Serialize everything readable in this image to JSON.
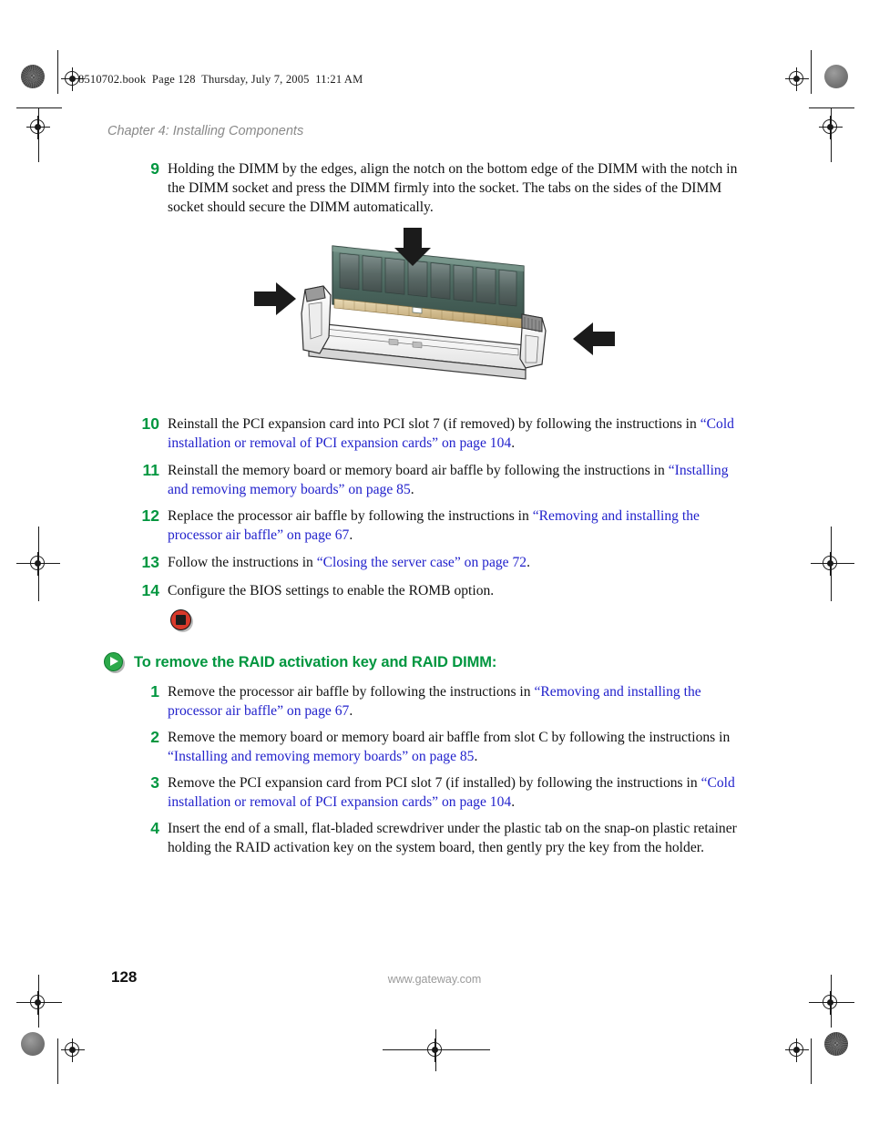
{
  "header": {
    "book_line": "8510702.book  Page 128  Thursday, July 7, 2005  11:21 AM",
    "chapter": "Chapter 4: Installing Components"
  },
  "footer": {
    "page_number": "128",
    "url": "www.gateway.com"
  },
  "colors": {
    "step_number_green": "#00963f",
    "xref_blue": "#2222cc",
    "heading_green": "#00963f",
    "stop_red": "#d8392b",
    "play_green": "#2ca94a",
    "chapter_gray": "#8a8a8a"
  },
  "steps_install": [
    {
      "number": "9",
      "parts": [
        {
          "text": "Holding the DIMM by the edges, align the notch on the bottom edge of the DIMM with the notch in the DIMM socket and press the DIMM firmly into the socket. The tabs on the sides of the DIMM socket should secure the DIMM automatically.",
          "style": "plain"
        }
      ]
    },
    {
      "number": "10",
      "parts": [
        {
          "text": "Reinstall the PCI expansion card into PCI slot 7 (if removed) by following the instructions in ",
          "style": "plain"
        },
        {
          "text": "“Cold installation or removal of PCI expansion cards” on page 104",
          "style": "xref"
        },
        {
          "text": ".",
          "style": "plain"
        }
      ]
    },
    {
      "number": "11",
      "parts": [
        {
          "text": "Reinstall the memory board or memory board air baffle by following the instructions in ",
          "style": "plain"
        },
        {
          "text": "“Installing and removing memory boards” on page 85",
          "style": "xref"
        },
        {
          "text": ".",
          "style": "plain"
        }
      ]
    },
    {
      "number": "12",
      "parts": [
        {
          "text": "Replace the processor air baffle by following the instructions in ",
          "style": "plain"
        },
        {
          "text": "“Removing and installing the processor air baffle” on page 67",
          "style": "xref"
        },
        {
          "text": ".",
          "style": "plain"
        }
      ]
    },
    {
      "number": "13",
      "parts": [
        {
          "text": "Follow the instructions in ",
          "style": "plain"
        },
        {
          "text": "“Closing the server case” on page 72",
          "style": "xref"
        },
        {
          "text": ".",
          "style": "plain"
        }
      ]
    },
    {
      "number": "14",
      "parts": [
        {
          "text": "Configure the BIOS settings to enable the ROMB option.",
          "style": "plain"
        }
      ]
    }
  ],
  "section": {
    "icon": "play-circle-icon",
    "title": "To remove the RAID activation key and RAID DIMM:"
  },
  "stop_marker": {
    "icon": "stop-circle-icon"
  },
  "steps_remove": [
    {
      "number": "1",
      "parts": [
        {
          "text": "Remove the processor air baffle by following the instructions in ",
          "style": "plain"
        },
        {
          "text": "“Removing and installing the processor air baffle” on page 67",
          "style": "xref"
        },
        {
          "text": ".",
          "style": "plain"
        }
      ]
    },
    {
      "number": "2",
      "parts": [
        {
          "text": "Remove the memory board or memory board air baffle from slot C by following the instructions in ",
          "style": "plain"
        },
        {
          "text": "“Installing and removing memory boards” on page 85",
          "style": "xref"
        },
        {
          "text": ".",
          "style": "plain"
        }
      ]
    },
    {
      "number": "3",
      "parts": [
        {
          "text": "Remove the PCI expansion card from PCI slot 7 (if installed) by following the instructions in ",
          "style": "plain"
        },
        {
          "text": "“Cold installation or removal of PCI expansion cards” on page 104",
          "style": "xref"
        },
        {
          "text": ".",
          "style": "plain"
        }
      ]
    },
    {
      "number": "4",
      "parts": [
        {
          "text": "Insert the end of a small, flat-bladed screwdriver under the plastic tab on the snap-on plastic retainer holding the RAID activation key on the system board, then gently pry the key from the holder.",
          "style": "plain"
        }
      ]
    }
  ],
  "figure": {
    "caption": "",
    "description": "DIMM memory module being pressed into a DIMM socket with retaining tabs",
    "arrows": [
      "down-arrow-top",
      "right-arrow-left",
      "left-arrow-right"
    ]
  }
}
